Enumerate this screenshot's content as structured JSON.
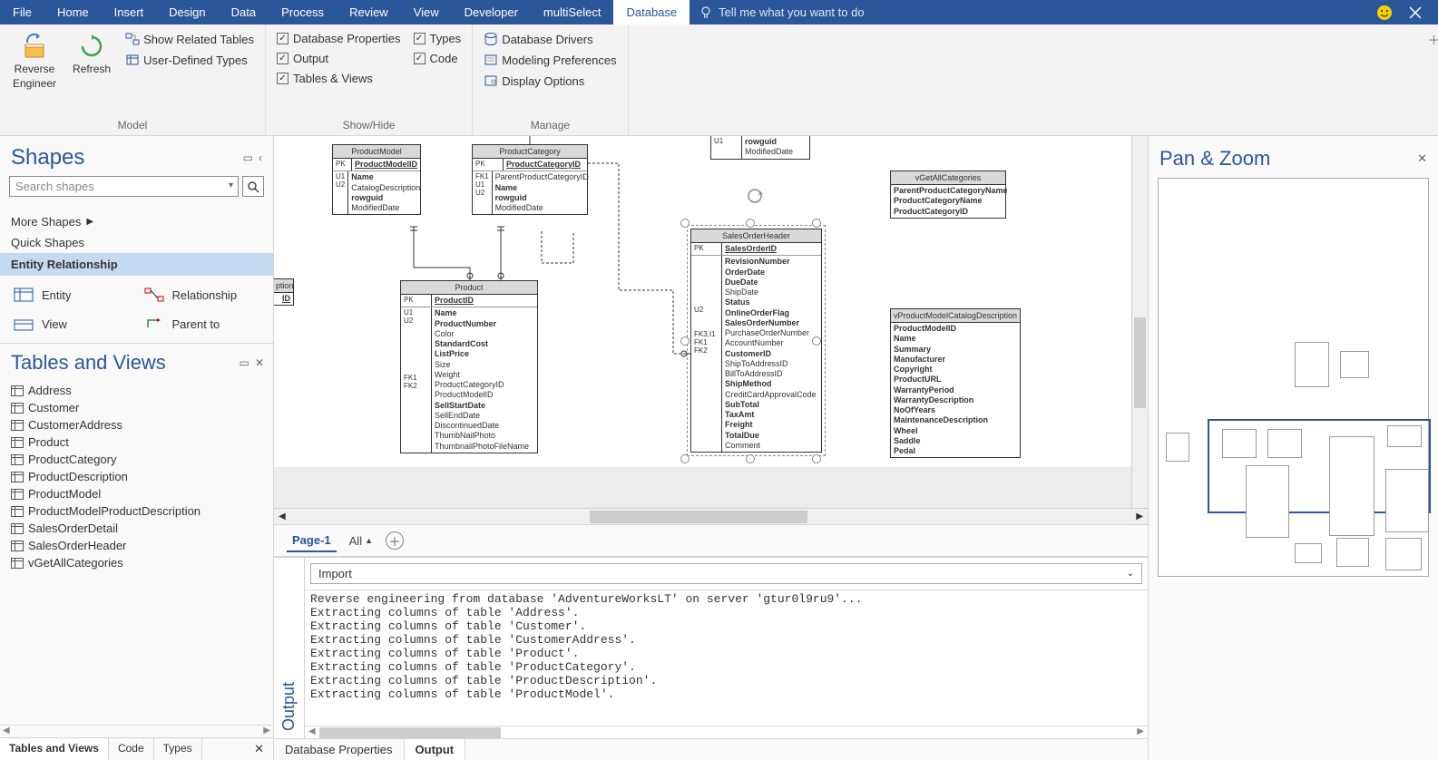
{
  "menu": {
    "items": [
      "File",
      "Home",
      "Insert",
      "Design",
      "Data",
      "Process",
      "Review",
      "View",
      "Developer",
      "multiSelect",
      "Database"
    ],
    "active": "Database",
    "tell_me": "Tell me what you want to do"
  },
  "ribbon": {
    "model": {
      "label": "Model",
      "reverse_engineer": "Reverse\nEngineer",
      "refresh": "Refresh",
      "show_related": "Show Related Tables",
      "user_defined": "User-Defined Types"
    },
    "show_hide": {
      "label": "Show/Hide",
      "database_properties": "Database Properties",
      "output": "Output",
      "tables_views": "Tables & Views",
      "types": "Types",
      "code": "Code"
    },
    "manage": {
      "label": "Manage",
      "database_drivers": "Database Drivers",
      "modeling_preferences": "Modeling Preferences",
      "display_options": "Display Options"
    }
  },
  "shapes": {
    "title": "Shapes",
    "search_placeholder": "Search shapes",
    "more_shapes": "More Shapes",
    "quick_shapes": "Quick Shapes",
    "category": "Entity Relationship",
    "items": [
      "Entity",
      "Relationship",
      "View",
      "Parent to"
    ]
  },
  "tables_views": {
    "title": "Tables and Views",
    "items": [
      "Address",
      "Customer",
      "CustomerAddress",
      "Product",
      "ProductCategory",
      "ProductDescription",
      "ProductModel",
      "ProductModelProductDescription",
      "SalesOrderDetail",
      "SalesOrderHeader",
      "vGetAllCategories"
    ],
    "tabs": [
      "Tables and Views",
      "Code",
      "Types"
    ]
  },
  "canvas": {
    "entities": {
      "product_description": {
        "title": "ption",
        "pk": "ID"
      },
      "product_model": {
        "title": "ProductModel",
        "rows": [
          {
            "key": "PK",
            "fields": [
              {
                "t": "ProductModelID",
                "c": "pk"
              }
            ]
          },
          {
            "key": "U1\nU2",
            "fields": [
              {
                "t": "Name",
                "c": "bold"
              },
              {
                "t": "CatalogDescription"
              },
              {
                "t": "rowguid",
                "c": "bold"
              },
              {
                "t": "ModifiedDate"
              }
            ]
          }
        ]
      },
      "product_category": {
        "title": "ProductCategory",
        "rows": [
          {
            "key": "PK",
            "fields": [
              {
                "t": "ProductCategoryID",
                "c": "pk"
              }
            ]
          },
          {
            "key": "FK1\nU1\nU2",
            "fields": [
              {
                "t": "ParentProductCategoryID"
              },
              {
                "t": "Name",
                "c": "bold"
              },
              {
                "t": "rowguid",
                "c": "bold"
              },
              {
                "t": "ModifiedDate"
              }
            ]
          }
        ]
      },
      "address_partial": {
        "rows": [
          {
            "key": "U1",
            "fields": [
              {
                "t": "rowguid",
                "c": "bold"
              },
              {
                "t": "ModifiedDate"
              }
            ]
          }
        ]
      },
      "vget_all_categories": {
        "title": "vGetAllCategories",
        "fields": [
          "ParentProductCategoryName",
          "ProductCategoryName",
          "ProductCategoryID"
        ]
      },
      "product": {
        "title": "Product",
        "rows": [
          {
            "key": "PK",
            "fields": [
              {
                "t": "ProductID",
                "c": "pk"
              }
            ]
          },
          {
            "key": "U1\nU2\n\n\n\n\n\n\nFK1\nFK2",
            "fields": [
              {
                "t": "Name",
                "c": "bold"
              },
              {
                "t": "ProductNumber",
                "c": "bold"
              },
              {
                "t": "Color"
              },
              {
                "t": "StandardCost",
                "c": "bold"
              },
              {
                "t": "ListPrice",
                "c": "bold"
              },
              {
                "t": "Size"
              },
              {
                "t": "Weight"
              },
              {
                "t": "ProductCategoryID"
              },
              {
                "t": "ProductModelID"
              },
              {
                "t": "SellStartDate",
                "c": "bold"
              },
              {
                "t": "SellEndDate"
              },
              {
                "t": "DiscontinuedDate"
              },
              {
                "t": "ThumbNailPhoto"
              },
              {
                "t": "ThumbnailPhotoFileName"
              }
            ]
          }
        ]
      },
      "sales_order_header": {
        "title": "SalesOrderHeader",
        "rows": [
          {
            "key": "PK",
            "fields": [
              {
                "t": "SalesOrderID",
                "c": "pk"
              }
            ]
          },
          {
            "key": "\n\n\n\n\n\nU2\n\n\nFK3,I1\nFK1\nFK2",
            "fields": [
              {
                "t": "RevisionNumber",
                "c": "bold"
              },
              {
                "t": "OrderDate",
                "c": "bold"
              },
              {
                "t": "DueDate",
                "c": "bold"
              },
              {
                "t": "ShipDate"
              },
              {
                "t": "Status",
                "c": "bold"
              },
              {
                "t": "OnlineOrderFlag",
                "c": "bold"
              },
              {
                "t": "SalesOrderNumber",
                "c": "bold"
              },
              {
                "t": "PurchaseOrderNumber"
              },
              {
                "t": "AccountNumber"
              },
              {
                "t": "CustomerID",
                "c": "bold"
              },
              {
                "t": "ShipToAddressID"
              },
              {
                "t": "BillToAddressID"
              },
              {
                "t": "ShipMethod",
                "c": "bold"
              },
              {
                "t": "CreditCardApprovalCode"
              },
              {
                "t": "SubTotal",
                "c": "bold"
              },
              {
                "t": "TaxAmt",
                "c": "bold"
              },
              {
                "t": "Freight",
                "c": "bold"
              },
              {
                "t": "TotalDue",
                "c": "bold"
              },
              {
                "t": "Comment"
              }
            ]
          }
        ]
      },
      "vproduct_model": {
        "title": "vProductModelCatalogDescription",
        "fields": [
          "ProductModelID",
          "Name",
          "Summary",
          "Manufacturer",
          "Copyright",
          "ProductURL",
          "WarrantyPeriod",
          "WarrantyDescription",
          "NoOfYears",
          "MaintenanceDescription",
          "Wheel",
          "Saddle",
          "Pedal"
        ]
      }
    }
  },
  "pages": {
    "current": "Page-1",
    "all": "All"
  },
  "output": {
    "title": "Output",
    "dropdown": "Import",
    "log": "Reverse engineering from database 'AdventureWorksLT' on server 'gtur0l9ru9'...\nExtracting columns of table 'Address'.\nExtracting columns of table 'Customer'.\nExtracting columns of table 'CustomerAddress'.\nExtracting columns of table 'Product'.\nExtracting columns of table 'ProductCategory'.\nExtracting columns of table 'ProductDescription'.\nExtracting columns of table 'ProductModel'."
  },
  "bottom_tabs": [
    "Database Properties",
    "Output"
  ],
  "pan_zoom": {
    "title": "Pan & Zoom"
  }
}
